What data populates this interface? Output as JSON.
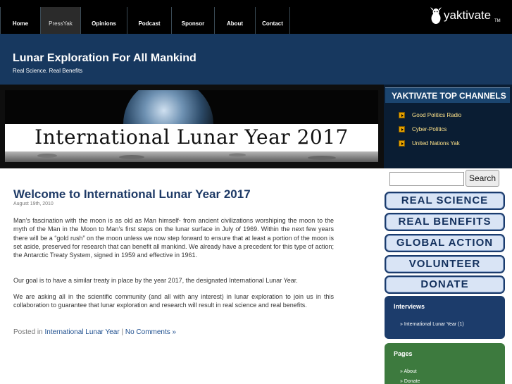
{
  "nav": {
    "items": [
      "Home",
      "PressYak",
      "Opinions",
      "Podcast",
      "Sponsor",
      "About",
      "Contact"
    ],
    "active": "PressYak"
  },
  "logo": {
    "brand": "yaktivate",
    "tm": "TM",
    "icon": "yak-icon"
  },
  "header": {
    "title": "Lunar Exploration For All Mankind",
    "tagline": "Real Science. Real Benefits"
  },
  "banner": {
    "text": "International Lunar Year 2017"
  },
  "channels": {
    "heading": "YAKTIVATE TOP CHANNELS",
    "items": [
      "Good Politics Radio",
      "Cyber-Politics",
      "United Nations Yak"
    ]
  },
  "post": {
    "title": "Welcome to International Lunar Year 2017",
    "date": "August 19th, 2010",
    "paragraphs": [
      "Man’s fascination with the moon is as old as Man himself- from ancient civilizations worshiping the moon to the myth of the Man in the Moon to Man’s first steps on the lunar surface in July of 1969. Within the next few years there will be a “gold rush” on the moon unless we now step forward to ensure that at least a portion of the moon is set aside, preserved for research that can benefit all mankind. We already have a precedent for this type of action; the Antarctic Treaty System, signed in 1959 and effective in 1961.",
      "Our goal is to have a similar treaty in place by the year 2017, the designated International Lunar Year.",
      "We are asking all in the scientific community (and all with any interest) in lunar exploration to join us in this collaboration to guarantee that lunar exploration and research will result in real science and real benefits."
    ],
    "posted_in_label": "Posted in",
    "category": "International Lunar Year",
    "separator": "|",
    "comments": "No Comments »"
  },
  "search": {
    "button": "Search",
    "value": ""
  },
  "sidebar": {
    "buttons": [
      "REAL SCIENCE",
      "REAL BENEFITS",
      "GLOBAL ACTION",
      "VOLUNTEER",
      "DONATE"
    ],
    "interviews": {
      "title": "Interviews",
      "items": [
        "» International Lunar Year (1)"
      ]
    },
    "pages": {
      "title": "Pages",
      "items": [
        "» About",
        "» Donate"
      ]
    }
  },
  "colors": {
    "nav_bg": "#000000",
    "header_bg": "#17385f",
    "post_title": "#1e3a66",
    "channel_text": "#ffe38a",
    "interviews_bg": "#1c3c6b",
    "pages_bg": "#3d7a3e"
  }
}
